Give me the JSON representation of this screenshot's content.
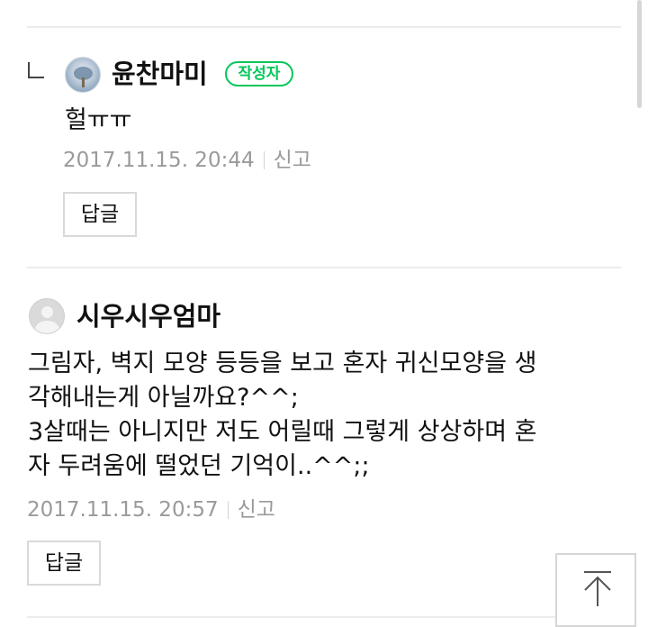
{
  "comments": [
    {
      "is_reply": true,
      "nickname": "윤찬마미",
      "badge": "작성자",
      "avatar": "photo-avatar",
      "text": "헐ㅠㅠ",
      "date": "2017.11.15. 20:44",
      "report_label": "신고",
      "reply_label": "답글"
    },
    {
      "is_reply": false,
      "nickname": "시우시우엄마",
      "avatar": "default-avatar",
      "text": "그림자, 벽지 모양 등등을 보고 혼자 귀신모양을 생\n각해내는게 아닐까요?^^;\n3살때는 아니지만 저도 어릴때 그렇게 상상하며 혼\n자 두려움에 떨었던 기억이..^^;;",
      "date": "2017.11.15. 20:57",
      "report_label": "신고",
      "reply_label": "답글"
    }
  ],
  "scroll_top_icon": "arrow-up-icon",
  "colors": {
    "accent": "#03c75a",
    "meta_text": "#9a9a9a",
    "divider": "#ececec"
  }
}
